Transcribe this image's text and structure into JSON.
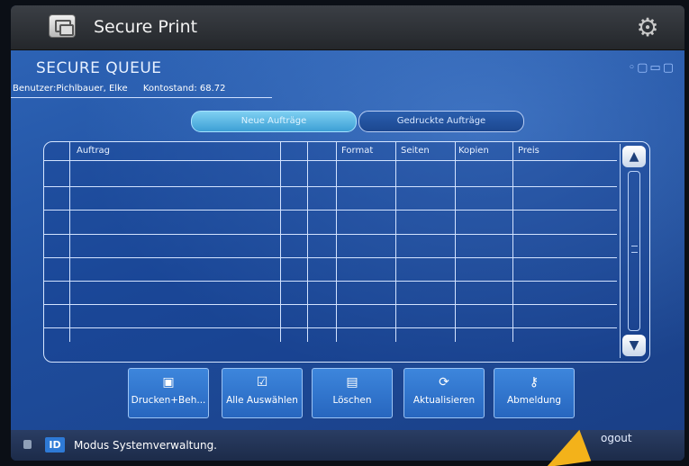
{
  "app": {
    "title": "Secure Print"
  },
  "panel": {
    "title": "SECURE QUEUE"
  },
  "user": {
    "label": "Benutzer:Pichlbauer, Elke",
    "balance_label": "Kontostand: 68.72"
  },
  "tabs": [
    {
      "label": "Neue Aufträge",
      "active": true
    },
    {
      "label": "Gedruckte Aufträge",
      "active": false
    }
  ],
  "table": {
    "columns": [
      "Auftrag",
      "",
      "",
      "Format",
      "Seiten",
      "Kopien",
      "Preis"
    ],
    "rows": []
  },
  "actions": [
    {
      "label": "Drucken+Beh...",
      "icon": "print-icon"
    },
    {
      "label": "Alle Auswählen",
      "icon": "select-all-icon"
    },
    {
      "label": "Löschen",
      "icon": "delete-icon"
    },
    {
      "label": "Aktualisieren",
      "icon": "refresh-icon"
    },
    {
      "label": "Abmeldung",
      "icon": "logout-keys-icon"
    }
  ],
  "status": {
    "text": "Modus Systemverwaltung.",
    "id_badge": "ID",
    "logout_partial": "ogout"
  },
  "colors": {
    "accent": "#2e7ad6",
    "panel": "#1e4d9d",
    "arrow": "#f3b21a"
  }
}
